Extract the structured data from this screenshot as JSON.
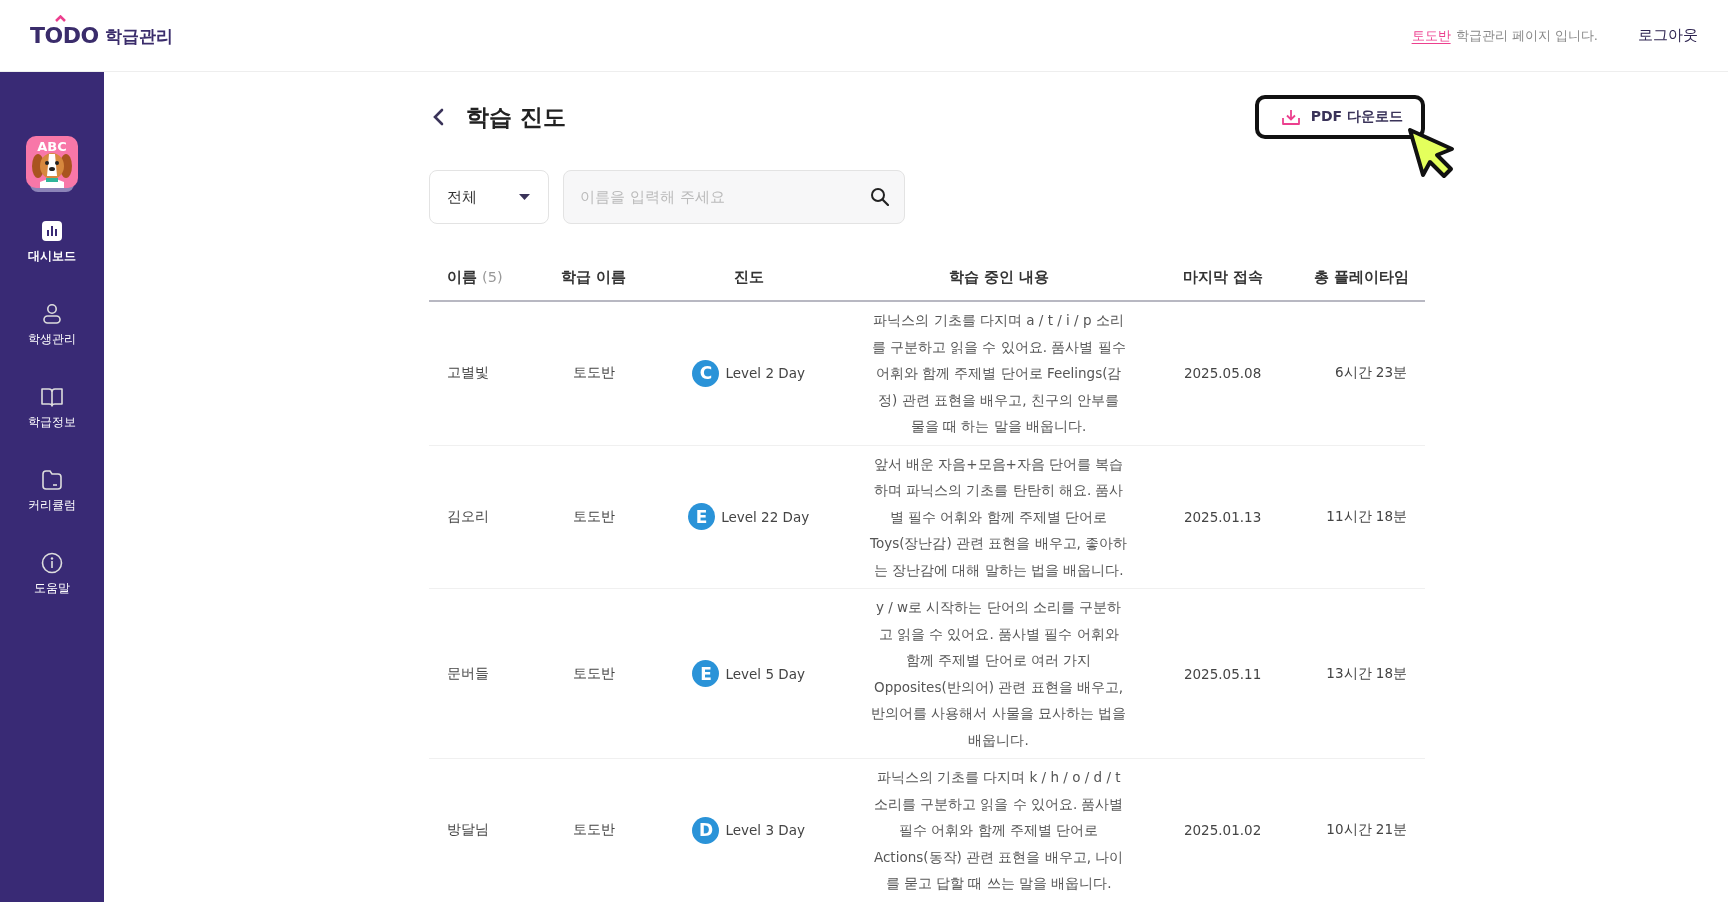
{
  "header": {
    "logo": "TODO",
    "logo_suffix": "학급관리",
    "class_link": "토도반",
    "notice": "학급관리 페이지 입니다.",
    "logout": "로그아웃"
  },
  "sidebar": {
    "app_icon_text": "ABC",
    "items": [
      {
        "label": "대시보드",
        "kind": "chart",
        "selected": true
      },
      {
        "label": "학생관리",
        "kind": "person",
        "selected": false
      },
      {
        "label": "학급정보",
        "kind": "book",
        "selected": false
      },
      {
        "label": "커리큘럼",
        "kind": "folder",
        "selected": false
      },
      {
        "label": "도움말",
        "kind": "info",
        "selected": false
      }
    ]
  },
  "page": {
    "title": "학습 진도",
    "pdf_button": "PDF 다운로드"
  },
  "filters": {
    "dropdown": "전체",
    "search": {
      "placeholder": "이름을 입력해 주세요"
    }
  },
  "table": {
    "columns": [
      {
        "label": "이름",
        "count": "(5)"
      },
      {
        "label": "학급 이름"
      },
      {
        "label": "진도"
      },
      {
        "label": "학습 중인 내용"
      },
      {
        "label": "마지막 접속"
      },
      {
        "label": "총 플레이타임"
      }
    ],
    "rows": [
      {
        "name": "고별빛",
        "class": "토도반",
        "badge": "C",
        "level": "Level 2 Day",
        "content": "파닉스의 기초를 다지며 a / t / i / p 소리를 구분하고 읽을 수 있어요. 품사별 필수 어휘와 함께 주제별 단어로 Feelings(감정) 관련 표현을 배우고, 친구의 안부를 물을 때 하는 말을 배웁니다.",
        "last_access": "2025.05.08",
        "playtime": "6시간 23분"
      },
      {
        "name": "김오리",
        "class": "토도반",
        "badge": "E",
        "level": "Level 22 Day",
        "content": "앞서 배운 자음+모음+자음 단어를 복습하며 파닉스의 기초를 탄탄히 해요. 품사별 필수 어휘와 함께 주제별 단어로 Toys(장난감) 관련 표현을 배우고, 좋아하는 장난감에 대해 말하는 법을 배웁니다.",
        "last_access": "2025.01.13",
        "playtime": "11시간 18분"
      },
      {
        "name": "문버들",
        "class": "토도반",
        "badge": "E",
        "level": "Level 5 Day",
        "content": "y / w로 시작하는 단어의 소리를 구분하고 읽을 수 있어요. 품사별 필수 어휘와 함께 주제별 단어로 여러 가지 Opposites(반의어) 관련 표현을 배우고, 반의어를 사용해서 사물을 묘사하는 법을 배웁니다.",
        "last_access": "2025.05.11",
        "playtime": "13시간 18분"
      },
      {
        "name": "방달님",
        "class": "토도반",
        "badge": "D",
        "level": "Level 3 Day",
        "content": "파닉스의 기초를 다지며 k / h / o / d / t 소리를 구분하고 읽을 수 있어요. 품사별 필수 어휘와 함께 주제별 단어로 Actions(동작) 관련 표현을 배우고, 나이를 묻고 답할 때 쓰는 말을 배웁니다.",
        "last_access": "2025.01.02",
        "playtime": "10시간 21분"
      }
    ]
  }
}
